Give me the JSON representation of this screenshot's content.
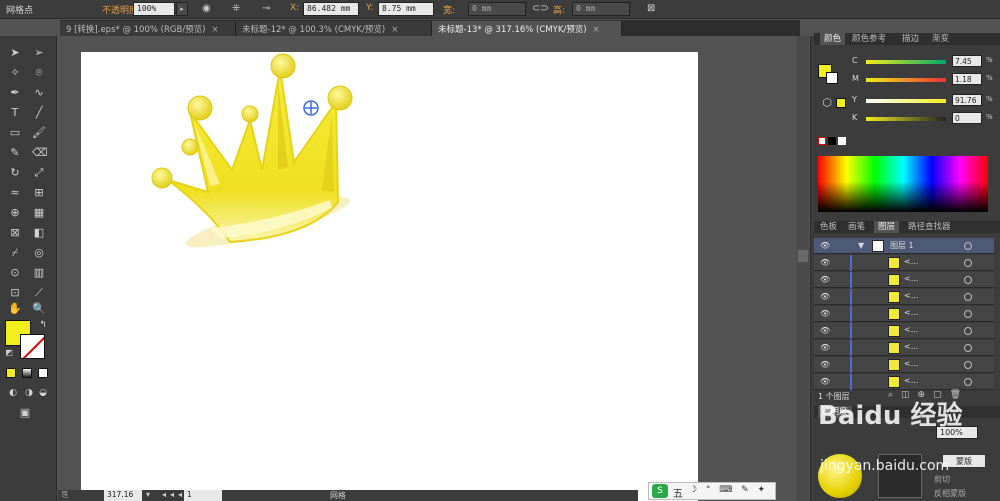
{
  "control_bar": {
    "mode_label": "网格点",
    "opacity_label": "不透明度：",
    "opacity_value": "100%",
    "x_label": "X:",
    "x_value": "86.482 mm",
    "y_label": "Y:",
    "y_value": "8.75 mm",
    "w_label": "宽:",
    "w_value": "0 mm",
    "h_label": "高:",
    "h_value": "0 mm"
  },
  "tabs": [
    {
      "label": "9 [转换].eps* @ 100% (RGB/预览)"
    },
    {
      "label": "未标题-12* @ 100.3% (CMYK/预览)"
    },
    {
      "label": "未标题-13* @ 317.16% (CMYK/预览)"
    }
  ],
  "color_panel": {
    "tabs": [
      "颜色",
      "颜色参考",
      "描边",
      "渐变"
    ],
    "sliders": [
      {
        "label": "C",
        "value": "7.45"
      },
      {
        "label": "M",
        "value": "1.18"
      },
      {
        "label": "Y",
        "value": "91.76"
      },
      {
        "label": "K",
        "value": "0"
      }
    ],
    "percent": "%"
  },
  "layers_panel": {
    "tabs": [
      "色板",
      "画笔",
      "图层",
      "路径查找器"
    ],
    "layer_name": "图层 1",
    "sublayer_label": "<...",
    "footer": "1 个图层"
  },
  "transparency_panel": {
    "tab": "透明度",
    "opacity": "100%",
    "mask_button": "蒙版",
    "clip_label": "剪切",
    "invert_label": "反相蒙版"
  },
  "status_bar": {
    "zoom": "317.16",
    "page": "1",
    "tool_label": "网格"
  },
  "ime": {
    "brand": "S",
    "mode": "五",
    "icons": "☽ ° ⌨ ✎ ✦"
  },
  "watermark": {
    "top": "Baidu 经验",
    "bottom": "jingyan.baidu.com"
  },
  "colors": {
    "fill": "#f2ee1c",
    "crown_yellow": "#f5e52a",
    "crown_dark": "#d9c41a",
    "background": "#535353"
  }
}
